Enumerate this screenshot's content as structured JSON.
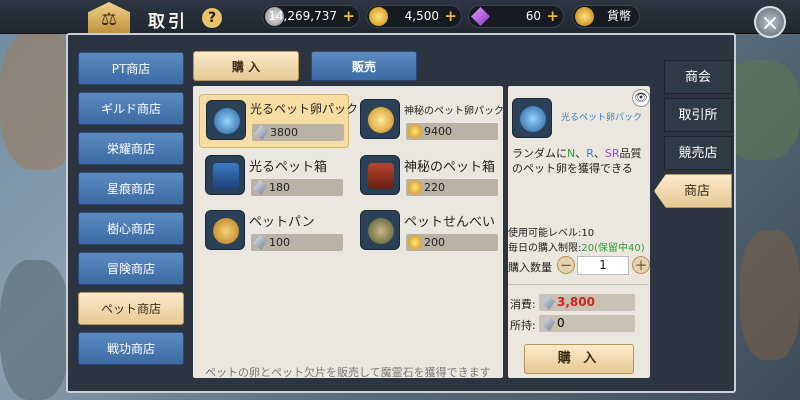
{
  "header": {
    "title": "取引",
    "help_label": "?",
    "close_label": "×",
    "currencies": [
      {
        "icon": "silver-coin-icon",
        "value": "14,269,737",
        "plus": "+"
      },
      {
        "icon": "gold-coin-icon",
        "value": "4,500",
        "plus": "+"
      },
      {
        "icon": "purple-gem-icon",
        "value": "60",
        "plus": "+"
      },
      {
        "icon": "currency-coin-icon",
        "value": "貨幣"
      }
    ]
  },
  "left_menu": {
    "items": [
      {
        "label": "PT商店"
      },
      {
        "label": "ギルド商店"
      },
      {
        "label": "栄耀商店"
      },
      {
        "label": "星痕商店"
      },
      {
        "label": "樹心商店"
      },
      {
        "label": "冒険商店"
      },
      {
        "label": "ペット商店"
      },
      {
        "label": "戦功商店"
      }
    ],
    "selected": "ペット商店"
  },
  "tabs": {
    "buy": "購 入",
    "sell": "販売"
  },
  "items": [
    {
      "name": "光るペット卵パック",
      "price": "3800",
      "currency": "crystal",
      "selected": true
    },
    {
      "name": "神秘のペット卵パック",
      "price": "9400",
      "currency": "gold"
    },
    {
      "name": "光るペット箱",
      "price": "180",
      "currency": "crystal"
    },
    {
      "name": "神秘のペット箱",
      "price": "220",
      "currency": "gold"
    },
    {
      "name": "ペットパン",
      "price": "100",
      "currency": "crystal"
    },
    {
      "name": "ペットせんべい",
      "price": "200",
      "currency": "gold"
    }
  ],
  "footnote": "ペットの卵とペット欠片を販売して魔霊石を獲得できます",
  "detail": {
    "name": "光るペット卵パック",
    "eye_label": "👁",
    "desc_pre": "ランダムに",
    "rarity_n": "N",
    "rarity_r": "R",
    "rarity_sr": "SR",
    "desc_post": "品質のペット卵を獲得できる",
    "sep": "、",
    "sep2": "、",
    "level_label": "使用可能レベル:10",
    "limit_label": "毎日の購入制限:",
    "limit_value": "20(保留中40)",
    "qty_label": "購入数量",
    "qty_minus": "−",
    "qty_value": "1",
    "qty_plus": "+",
    "cost_label": "消費:",
    "cost_value": "3,800",
    "own_label": "所持:",
    "own_value": "0",
    "buy_label": "購 入"
  },
  "right_tabs": [
    {
      "label": "商会"
    },
    {
      "label": "取引所"
    },
    {
      "label": "競売店"
    },
    {
      "label": "商店"
    }
  ],
  "right_selected": "商店"
}
